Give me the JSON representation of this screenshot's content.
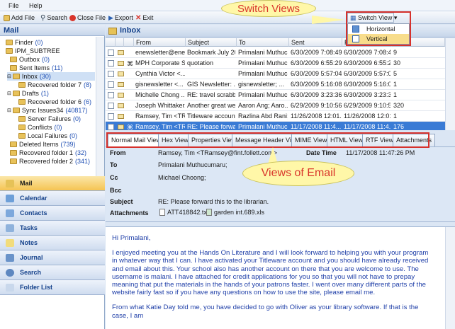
{
  "menu": {
    "file": "File",
    "help": "Help"
  },
  "toolbar": {
    "add_file": "Add File",
    "search": "Search",
    "close_file": "Close File",
    "export": "Export",
    "exit": "Exit"
  },
  "switch_view": {
    "button": "Switch View",
    "options": [
      "Horizontal",
      "Vertical"
    ],
    "highlighted": "Vertical"
  },
  "callouts": {
    "switch": "Switch Views",
    "views": "Views of Email"
  },
  "left": {
    "header": "Mail",
    "tree": [
      {
        "label": "Finder",
        "count": "(0)"
      },
      {
        "label": "IPM_SUBTREE",
        "count": ""
      },
      {
        "label": "Outbox",
        "count": "(0)"
      },
      {
        "label": "Sent Items",
        "count": "(11)"
      },
      {
        "label": "Inbox",
        "count": "(30)"
      },
      {
        "label": "Recovered folder 7",
        "count": "(8)"
      },
      {
        "label": "Drafts",
        "count": "(1)"
      },
      {
        "label": "Recovered folder 6",
        "count": "(6)"
      },
      {
        "label": "Sync Issues34",
        "count": "(40817)"
      },
      {
        "label": "Server Failures",
        "count": "(0)"
      },
      {
        "label": "Conflicts",
        "count": "(0)"
      },
      {
        "label": "Local Failures",
        "count": "(0)"
      },
      {
        "label": "Deleted Items",
        "count": "(739)"
      },
      {
        "label": "Recovered folder 1",
        "count": "(32)"
      },
      {
        "label": "Recovered folder 2",
        "count": "(341)"
      }
    ],
    "nav": [
      "Mail",
      "Calendar",
      "Contacts",
      "Tasks",
      "Notes",
      "Journal",
      "Search",
      "Folder List"
    ]
  },
  "inbox": {
    "title": "Inbox",
    "columns": [
      "From",
      "Subject",
      "To",
      "Sent",
      "R",
      "S"
    ],
    "rows": [
      {
        "from": "enewsletter@ene...",
        "subject": "Bookmark July 20...",
        "to": "Primalani Muthuc...",
        "sent": "6/30/2009 7:08:49...",
        "r": "6/30/2009 7:08:49...",
        "size": "9"
      },
      {
        "from": "MPH Corporate S...",
        "subject": "quotation",
        "to": "Primalani Muthuc...",
        "sent": "6/30/2009 6:55:29...",
        "r": "6/30/2009 6:55:29...",
        "size": "30"
      },
      {
        "from": "Cynthia Victor <...",
        "subject": "",
        "to": "Primalani Muthuc...",
        "sent": "6/30/2009 5:57:04...",
        "r": "6/30/2009 5:57:04...",
        "size": "5"
      },
      {
        "from": "gisnewsletter <...",
        "subject": "GIS Newsletter: ...",
        "to": "gisnewsletter; ...",
        "sent": "6/30/2009 5:16:08...",
        "r": "6/30/2009 5:16:08...",
        "size": "1"
      },
      {
        "from": "Michelle Chong ...",
        "subject": "RE: travel scrabble",
        "to": "Primalani Muthuc...",
        "sent": "6/30/2009 3:23:36...",
        "r": "6/30/2009 3:23:36...",
        "size": "1"
      },
      {
        "from": "Joseph Whittaker...",
        "subject": "Another great we...",
        "to": "Aaron Ang; Aaro...",
        "sent": "6/29/2009 9:10:56...",
        "r": "6/29/2009 9:10:56...",
        "size": "320"
      },
      {
        "from": "Ramsey, Tim <TR...",
        "subject": "Titleware accounts",
        "to": "Razlina Abd Rani;...",
        "sent": "11/26/2008 12:01...",
        "r": "11/26/2008 12:01...",
        "size": "1"
      },
      {
        "from": "Ramsey, Tim <TRa...",
        "subject": "RE: Please forwar...",
        "to": "Primalani Muthuc...",
        "sent": "11/17/2008 11:4...",
        "r": "11/17/2008 11:4...",
        "size": "176"
      }
    ]
  },
  "tabs": [
    "Normal Mail View",
    "Hex View",
    "Properties View",
    "Message Header View",
    "MIME View",
    "HTML View",
    "RTF View",
    "Attachments"
  ],
  "headers": {
    "from_label": "From",
    "from": "Ramsey, Tim <TRamsey@fint.follett.com>",
    "date_label": "Date Time",
    "date": "11/17/2008 11:47:26 PM",
    "to_label": "To",
    "to": "Primalani Muthucumaru;",
    "cc_label": "Cc",
    "cc": "Michael Choong;",
    "bcc_label": "Bcc",
    "bcc": "",
    "subject_label": "Subject",
    "subject": "RE: Please forward this to the librarian.",
    "attach_label": "Attachments",
    "attach1": "ATT418842.txt",
    "attach2": "garden int.689.xls"
  },
  "body": {
    "p1": "Hi Primalani,",
    "p2": "I enjoyed meeting you at the Hands On Literature and I will look forward to helping you with your program in whatever way that I can.  I have activated your Titleware account and you should have already received and email about this. Your school also has another account on there that you are welcome to use.  The username is malani.  I have attached for credit applications for you so that you will not have to prepay meaning that put the materials in the hands of your patrons faster.  I went over many different parts of the website fairly fast so if you have any questions on how to use the site, please email me.",
    "p3": "From what Katie Day told me, you have decided to go with Oliver as your library software.  If that is the case, I am"
  },
  "colors": {
    "accent": "#3a7bd5",
    "highlight_red": "#d6312c",
    "callout_fill": "#fff7a8",
    "nav_active": "#f5c453",
    "body_text": "#1f3fa8"
  }
}
